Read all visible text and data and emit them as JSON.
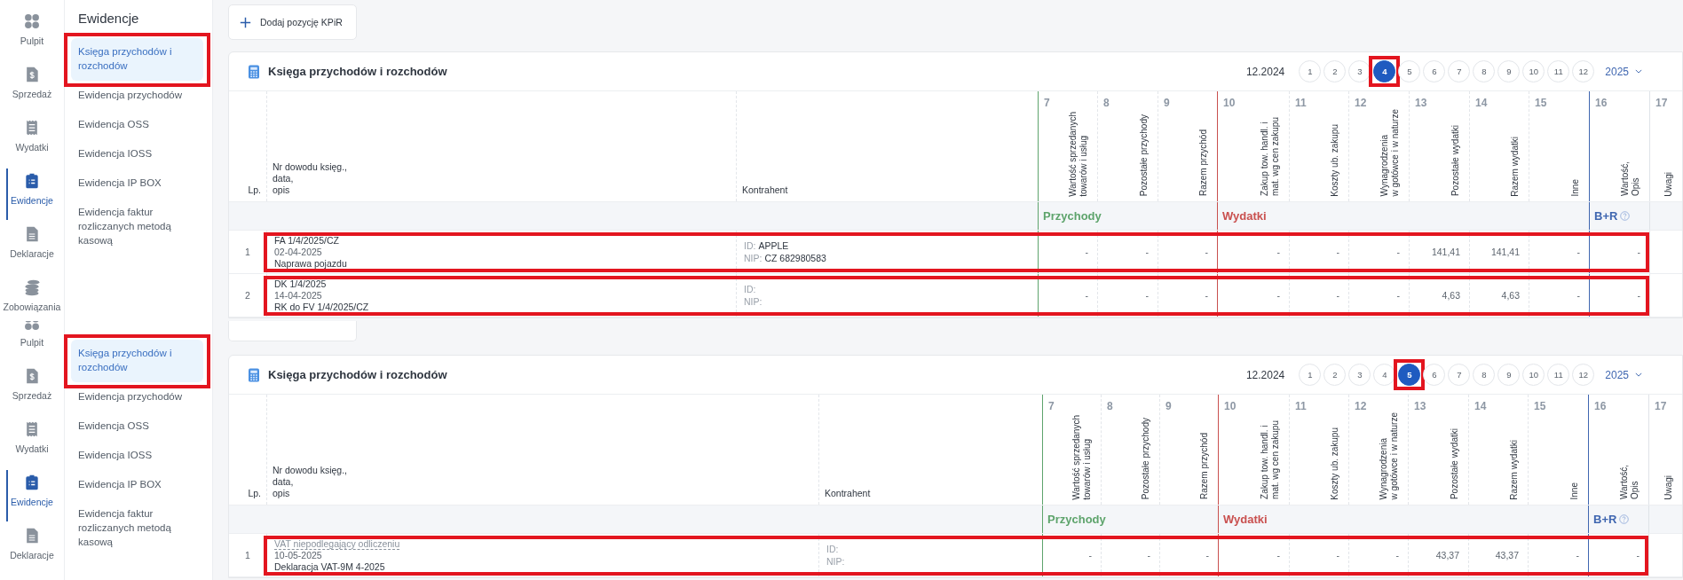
{
  "panels": [
    {
      "rail": [
        {
          "label": "Pulpit",
          "selected": false
        },
        {
          "label": "Sprzedaż",
          "selected": false
        },
        {
          "label": "Wydatki",
          "selected": false
        },
        {
          "label": "Ewidencje",
          "selected": true
        },
        {
          "label": "Deklaracje",
          "selected": false
        },
        {
          "label": "Zobowiązania",
          "selected": false
        }
      ],
      "nav": {
        "title": "Ewidencje",
        "items": [
          {
            "label": "Księga przychodów i rozchodów",
            "selected": true,
            "highlighted": true
          },
          {
            "label": "Ewidencja przychodów",
            "selected": false,
            "highlighted": false
          },
          {
            "label": "Ewidencja OSS",
            "selected": false,
            "highlighted": false
          },
          {
            "label": "Ewidencja IOSS",
            "selected": false,
            "highlighted": false
          },
          {
            "label": "Ewidencja IP BOX",
            "selected": false,
            "highlighted": false
          },
          {
            "label": "Ewidencja faktur rozliczanych metodą kasową",
            "selected": false,
            "highlighted": false
          }
        ]
      },
      "add_button": "Dodaj pozycję KPiR",
      "card": {
        "title": "Księga przychodów i rozchodów",
        "period": "12.2024",
        "year": "2025",
        "months": [
          {
            "label": "1",
            "selected": false,
            "highlighted": false
          },
          {
            "label": "2",
            "selected": false,
            "highlighted": false
          },
          {
            "label": "3",
            "selected": false,
            "highlighted": false
          },
          {
            "label": "4",
            "selected": true,
            "highlighted": true
          },
          {
            "label": "5",
            "selected": false,
            "highlighted": false
          },
          {
            "label": "6",
            "selected": false,
            "highlighted": false
          },
          {
            "label": "7",
            "selected": false,
            "highlighted": false
          },
          {
            "label": "8",
            "selected": false,
            "highlighted": false
          },
          {
            "label": "9",
            "selected": false,
            "highlighted": false
          },
          {
            "label": "10",
            "selected": false,
            "highlighted": false
          },
          {
            "label": "11",
            "selected": false,
            "highlighted": false
          },
          {
            "label": "12",
            "selected": false,
            "highlighted": false
          }
        ]
      },
      "table": {
        "lead_columns": [
          "Lp.",
          "Nr dowodu księg.,\ndata,\nopis",
          "Kontrahent"
        ],
        "groups": [
          {
            "label": "Przychody",
            "color": "#5ea46c",
            "columns": [
              {
                "number": "7",
                "label": "Wartość sprzedanych\ntowarów i usług"
              },
              {
                "number": "8",
                "label": "Pozostałe przychody"
              },
              {
                "number": "9",
                "label": "Razem przychód"
              }
            ]
          },
          {
            "label": "Wydatki",
            "color": "#c9504f",
            "columns": [
              {
                "number": "10",
                "label": "Zakup tow. handl. i\nmat. wg cen zakupu"
              },
              {
                "number": "11",
                "label": "Koszty ub. zakupu"
              },
              {
                "number": "12",
                "label": "Wynagrodzenia\nw gotówce i w naturze"
              },
              {
                "number": "13",
                "label": "Pozostałe wydatki"
              },
              {
                "number": "14",
                "label": "Razem wydatki"
              },
              {
                "number": "15",
                "label": "Inne"
              }
            ]
          },
          {
            "label": "B+R",
            "color": "#3f66b0",
            "help_icon": true,
            "columns": [
              {
                "number": "16",
                "label": "Wartość,\nOpis"
              }
            ]
          },
          {
            "columns": [
              {
                "number": "17",
                "label": "Uwagi"
              }
            ]
          }
        ],
        "rows": [
          {
            "lp": "1",
            "doc_number": "FA 1/4/2025/CZ",
            "underlined": false,
            "date": "02-04-2025",
            "description": "Naprawa pojazdu",
            "id_label": "ID:",
            "id": "APPLE",
            "nip_label": "NIP:",
            "nip": "CZ 682980583",
            "highlighted": true,
            "values": [
              "-",
              "-",
              "-",
              "-",
              "-",
              "-",
              "141,41",
              "141,41",
              "-",
              "-"
            ]
          },
          {
            "lp": "2",
            "doc_number": "DK 1/4/2025",
            "underlined": false,
            "date": "14-04-2025",
            "description": "RK do FV 1/4/2025/CZ",
            "id_label": "ID:",
            "nip_label": "NIP:",
            "highlighted": true,
            "values": [
              "-",
              "-",
              "-",
              "-",
              "-",
              "-",
              "4,63",
              "4,63",
              "-",
              "-"
            ]
          }
        ]
      }
    },
    {
      "rail": [
        {
          "label": "Pulpit",
          "selected": false
        },
        {
          "label": "Sprzedaż",
          "selected": false
        },
        {
          "label": "Wydatki",
          "selected": false
        },
        {
          "label": "Ewidencje",
          "selected": true
        },
        {
          "label": "Deklaracje",
          "selected": false
        }
      ],
      "nav": {
        "items": [
          {
            "label": "Księga przychodów i rozchodów",
            "selected": true,
            "highlighted": true
          },
          {
            "label": "Ewidencja przychodów",
            "selected": false,
            "highlighted": false
          },
          {
            "label": "Ewidencja OSS",
            "selected": false,
            "highlighted": false
          },
          {
            "label": "Ewidencja IOSS",
            "selected": false,
            "highlighted": false
          },
          {
            "label": "Ewidencja IP BOX",
            "selected": false,
            "highlighted": false
          },
          {
            "label": "Ewidencja faktur rozliczanych metodą kasową",
            "selected": false,
            "highlighted": false
          }
        ]
      },
      "card": {
        "title": "Księga przychodów i rozchodów",
        "period": "12.2024",
        "year": "2025",
        "months": [
          {
            "label": "1",
            "selected": false,
            "highlighted": false
          },
          {
            "label": "2",
            "selected": false,
            "highlighted": false
          },
          {
            "label": "3",
            "selected": false,
            "highlighted": false
          },
          {
            "label": "4",
            "selected": false,
            "highlighted": false
          },
          {
            "label": "5",
            "selected": true,
            "highlighted": true
          },
          {
            "label": "6",
            "selected": false,
            "highlighted": false
          },
          {
            "label": "7",
            "selected": false,
            "highlighted": false
          },
          {
            "label": "8",
            "selected": false,
            "highlighted": false
          },
          {
            "label": "9",
            "selected": false,
            "highlighted": false
          },
          {
            "label": "10",
            "selected": false,
            "highlighted": false
          },
          {
            "label": "11",
            "selected": false,
            "highlighted": false
          },
          {
            "label": "12",
            "selected": false,
            "highlighted": false
          }
        ]
      },
      "table": {
        "lead_columns": [
          "Lp.",
          "Nr dowodu księg.,\ndata,\nopis",
          "Kontrahent"
        ],
        "groups": [
          {
            "label": "Przychody",
            "color": "#5ea46c",
            "columns": [
              {
                "number": "7",
                "label": "Wartość sprzedanych\ntowarów i usług"
              },
              {
                "number": "8",
                "label": "Pozostałe przychody"
              },
              {
                "number": "9",
                "label": "Razem przychód"
              }
            ]
          },
          {
            "label": "Wydatki",
            "color": "#c9504f",
            "columns": [
              {
                "number": "10",
                "label": "Zakup tow. handl. i\nmat. wg cen zakupu"
              },
              {
                "number": "11",
                "label": "Koszty ub. zakupu"
              },
              {
                "number": "12",
                "label": "Wynagrodzenia\nw gotówce i w naturze"
              },
              {
                "number": "13",
                "label": "Pozostałe wydatki"
              },
              {
                "number": "14",
                "label": "Razem wydatki"
              },
              {
                "number": "15",
                "label": "Inne"
              }
            ]
          },
          {
            "label": "B+R",
            "color": "#3f66b0",
            "help_icon": true,
            "columns": [
              {
                "number": "16",
                "label": "Wartość,\nOpis"
              }
            ]
          },
          {
            "columns": [
              {
                "number": "17",
                "label": "Uwagi"
              }
            ]
          }
        ],
        "rows": [
          {
            "lp": "1",
            "doc_number": "VAT niepodlegający odliczeniu",
            "underlined": true,
            "date": "10-05-2025",
            "description": "Deklaracja VAT-9M 4-2025",
            "id_label": "ID:",
            "nip_label": "NIP:",
            "highlighted": true,
            "values": [
              "-",
              "-",
              "-",
              "-",
              "-",
              "-",
              "43,37",
              "43,37",
              "-",
              "-"
            ]
          }
        ]
      }
    }
  ]
}
